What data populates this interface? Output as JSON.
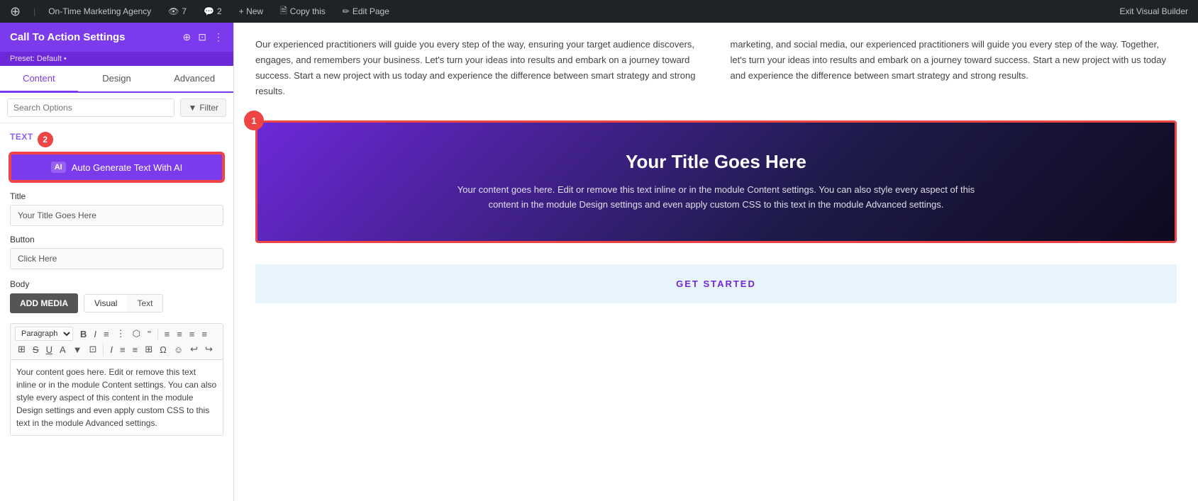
{
  "adminBar": {
    "wpIcon": "W",
    "siteName": "On-Time Marketing Agency",
    "eyeCount": "7",
    "commentCount": "2",
    "newLabel": "+ New",
    "copyLabel": "Copy this",
    "editPageLabel": "Edit Page",
    "exitBuilderLabel": "Exit Visual Builder"
  },
  "leftPanel": {
    "title": "Call To Action Settings",
    "preset": "Preset: Default •",
    "tabs": [
      {
        "id": "content",
        "label": "Content"
      },
      {
        "id": "design",
        "label": "Design"
      },
      {
        "id": "advanced",
        "label": "Advanced"
      }
    ],
    "activeTab": "content",
    "search": {
      "placeholder": "Search Options",
      "filterLabel": "Filter"
    },
    "textSection": {
      "label": "Text",
      "badgeNumber": "2",
      "aiButton": "Auto Generate Text With AI",
      "aiIconText": "AI"
    },
    "titleField": {
      "label": "Title",
      "value": "Your Title Goes Here"
    },
    "buttonField": {
      "label": "Button",
      "value": "Click Here"
    },
    "bodySection": {
      "label": "Body",
      "addMediaLabel": "ADD MEDIA",
      "visualTabLabel": "Visual",
      "textTabLabel": "Text"
    },
    "toolbar": {
      "paragraphSelect": "Paragraph",
      "buttons": [
        "B",
        "I",
        "≡",
        "≡",
        "⬡",
        "\""
      ],
      "row2": [
        "≡",
        "≡",
        "≡",
        "≡",
        "⊞",
        "S",
        "U",
        "A",
        "▼",
        "⊡"
      ],
      "row3": [
        "I",
        "≡",
        "≡",
        "⊞",
        "Ω",
        "☺",
        "↩",
        "↪"
      ]
    },
    "bodyText": "Your content goes here. Edit or remove this text inline or in the module Content settings. You can also style every aspect of this content in the module Design settings and even apply custom CSS to this text in the module Advanced settings."
  },
  "mainContent": {
    "column1": {
      "text1": "Our experienced practitioners will guide you every step of the way, ensuring your target audience discovers, engages, and remembers your business. Let's turn your ideas into results and embark on a journey toward success. Start a new project with us today and experience the difference between smart strategy and strong results."
    },
    "column2": {
      "text1": "marketing, and social media, our experienced practitioners will guide you every step of the way. Together, let's turn your ideas into results and embark on a journey toward success. Start a new project with us today and experience the difference between smart strategy and strong results."
    },
    "ctaModule": {
      "badge": "1",
      "title": "Your Title Goes Here",
      "body": "Your content goes here. Edit or remove this text inline or in the module Content settings. You can also style every aspect of this content in the module Design settings and even apply custom CSS to this text in the module Advanced settings."
    },
    "getStarted": {
      "label": "GET STARTED"
    }
  }
}
